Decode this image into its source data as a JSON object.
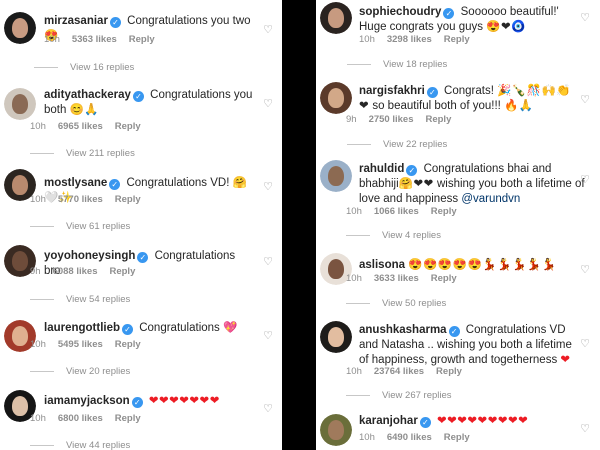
{
  "left_comments": [
    {
      "username": "mirzasaniar",
      "text": "Congratulations you two",
      "emoji": "😍",
      "time": "10h",
      "likes": "5363 likes",
      "reply": "Reply",
      "view_replies": "View 16 replies"
    },
    {
      "username": "adityathackeray",
      "text": "Congratulations you both",
      "emoji": "😊🙏",
      "time": "10h",
      "likes": "6965 likes",
      "reply": "Reply",
      "view_replies": "View 211 replies"
    },
    {
      "username": "mostlysane",
      "text": "Congratulations VD!",
      "emoji": "🤗🤍✨",
      "time": "10h",
      "likes": "5770 likes",
      "reply": "Reply",
      "view_replies": "View 61 replies"
    },
    {
      "username": "yoyohoneysingh",
      "text": "Congratulations bro",
      "emoji": "",
      "time": "9h",
      "likes": "6088 likes",
      "reply": "Reply",
      "view_replies": "View 54 replies"
    },
    {
      "username": "laurengottlieb",
      "text": "Congratulations",
      "emoji": "💖",
      "time": "10h",
      "likes": "5495 likes",
      "reply": "Reply",
      "view_replies": "View 20 replies"
    },
    {
      "username": "iamamyjackson",
      "text": "",
      "emoji": "❤❤❤❤❤❤❤",
      "time": "10h",
      "likes": "6800 likes",
      "reply": "Reply",
      "view_replies": "View 44 replies"
    }
  ],
  "right_comments": [
    {
      "username": "sophiechoudry",
      "text": "Soooooo beautiful!' Huge congrats you guys",
      "emoji": "😍❤🧿",
      "time": "10h",
      "likes": "3298 likes",
      "reply": "Reply",
      "view_replies": "View 18 replies"
    },
    {
      "username": "nargisfakhri",
      "text": "Congrats!",
      "text2": "so beautiful both of you!!!",
      "emoji": "🎉🍾🎊🙌👏❤",
      "emoji2": "🔥🙏",
      "time": "9h",
      "likes": "2750 likes",
      "reply": "Reply",
      "view_replies": "View 22 replies"
    },
    {
      "username": "rahuldid",
      "text": "Congratulations bhai and bhabhiji",
      "text2": "wishing you both a lifetime of love and happiness",
      "mention": "@varundvn",
      "emoji": "🤗❤❤",
      "time": "10h",
      "likes": "1066 likes",
      "reply": "Reply",
      "view_replies": "View 4 replies"
    },
    {
      "username": "aslisona",
      "text": "",
      "emoji": "😍😍😍😍😍💃💃💃💃💃",
      "time": "10h",
      "likes": "3633 likes",
      "reply": "Reply",
      "view_replies": "View 50 replies"
    },
    {
      "username": "anushkasharma",
      "text": "Congratulations VD and Natasha .. wishing you both a lifetime of happiness, growth and togetherness",
      "emoji": "❤",
      "time": "10h",
      "likes": "23764 likes",
      "reply": "Reply",
      "view_replies": "View 267 replies"
    },
    {
      "username": "karanjohar",
      "text": "",
      "emoji": "❤❤❤❤❤❤❤❤❤",
      "time": "10h",
      "likes": "6490 likes",
      "reply": "Reply",
      "view_replies": ""
    }
  ],
  "icons": {
    "verified": "verified-badge-icon",
    "like": "heart-outline-icon"
  },
  "colors": {
    "verified": "#3897f0",
    "meta": "#8e8e8e",
    "text": "#262626",
    "divider": "#000000"
  }
}
